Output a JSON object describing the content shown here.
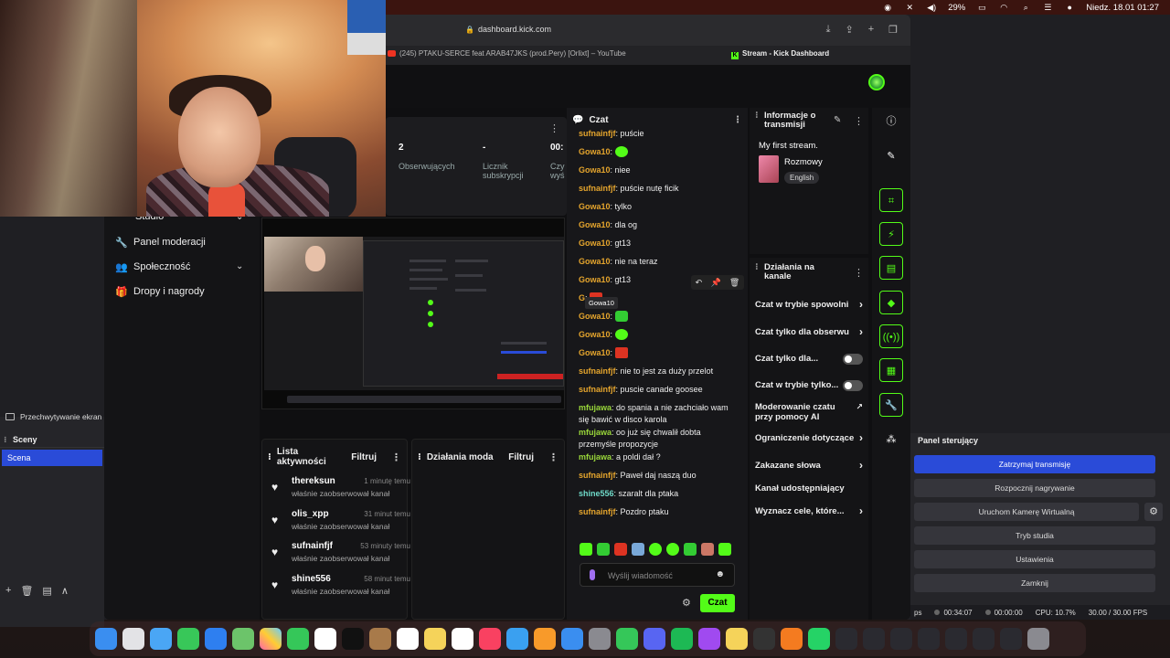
{
  "menubar": {
    "battery": "29%",
    "datetime": "Niedz. 18.01  01:27"
  },
  "obs": {
    "capture_label": "Przechwytywanie ekran",
    "scenes_title": "Sceny",
    "scene_item": "Scena",
    "controls_title": "Panel sterujący",
    "buttons": {
      "stop_stream": "Zatrzymaj transmisję",
      "start_record": "Rozpocznij nagrywanie",
      "virtual_cam": "Uruchom Kamerę Wirtualną",
      "studio_mode": "Tryb studia",
      "settings": "Ustawienia",
      "exit": "Zamknij"
    },
    "status": {
      "left_cut": "ps",
      "stream_time": "00:34:07",
      "record_time": "00:00:00",
      "cpu": "CPU: 10.7%",
      "fps": "30.00 / 30.00 FPS"
    }
  },
  "browser": {
    "url": "dashboard.kick.com",
    "tabs": [
      "(245) PTAKU-SERCE feat ARAB47JKS (prod.Pery) [Orlixt] – YouTube",
      "Stream - Kick Dashboard"
    ]
  },
  "nav": {
    "studio": "Studio",
    "moderation": "Panel moderacji",
    "community": "Społeczność",
    "drops": "Dropy i nagrody"
  },
  "stats": {
    "followers_value": "2",
    "followers_label": "Obserwujących",
    "subs_value": "-",
    "subs_label": "Licznik subskrypcji",
    "time_value": "00:",
    "time_label": "Czy wyś"
  },
  "activity": {
    "title": "Lista aktywności",
    "filter": "Filtruj",
    "items": [
      {
        "name": "thereksun",
        "time": "1 minutę temu",
        "desc": "właśnie zaobserwował kanał"
      },
      {
        "name": "olis_xpp",
        "time": "31 minut temu",
        "desc": "właśnie zaobserwował kanał"
      },
      {
        "name": "sufnainfjf",
        "time": "53 minuty temu",
        "desc": "właśnie zaobserwował kanał"
      },
      {
        "name": "shine556",
        "time": "58 minut temu",
        "desc": "właśnie zaobserwował kanał"
      }
    ]
  },
  "modactions": {
    "title": "Działania moda",
    "filter": "Filtruj"
  },
  "chat": {
    "title": "Czat",
    "tooltip": "Gowa10",
    "messages": [
      {
        "user": "sufnainfjf",
        "text": "puście",
        "color": "#e5a52d"
      },
      {
        "user": "Gowa10",
        "text": "",
        "emote": "g",
        "color": "#e5a52d"
      },
      {
        "user": "Gowa10",
        "text": "niee",
        "color": "#e5a52d"
      },
      {
        "user": "sufnainfjf",
        "text": "puście nutę ficik",
        "color": "#e5a52d"
      },
      {
        "user": "Gowa10",
        "text": "tylko",
        "color": "#e5a52d"
      },
      {
        "user": "Gowa10",
        "text": "dla og",
        "color": "#e5a52d"
      },
      {
        "user": "Gowa10",
        "text": "gt13",
        "color": "#e5a52d"
      },
      {
        "user": "Gowa10",
        "text": "nie na teraz",
        "color": "#e5a52d"
      },
      {
        "user": "Gowa10",
        "text": "gt13",
        "color": "#e5a52d"
      },
      {
        "user": "G",
        "text": "",
        "emote": "r",
        "color": "#e5a52d"
      },
      {
        "user": "Gowa10",
        "text": "",
        "emote": "gc",
        "color": "#e5a52d"
      },
      {
        "user": "Gowa10",
        "text": "",
        "emote": "g",
        "color": "#e5a52d"
      },
      {
        "user": "Gowa10",
        "text": "",
        "emote": "r",
        "color": "#e5a52d"
      },
      {
        "user": "sufnainfjf",
        "text": "nie to jest za duży przelot",
        "color": "#e5a52d"
      },
      {
        "user": "sufnainfjf",
        "text": "puscie canade goosee",
        "color": "#e5a52d"
      },
      {
        "user": "mfujawa",
        "text": "do spania a nie zachciało wam się bawić w disco karola",
        "color": "#9ad83a"
      },
      {
        "user": "mfujawa",
        "text": "oo już się chwalił dobta przemyśle propozycje",
        "color": "#9ad83a"
      },
      {
        "user": "mfujawa",
        "text": "a poldi dał ?",
        "color": "#9ad83a"
      },
      {
        "user": "sufnainfjf",
        "text": "Paweł daj naszą duo",
        "color": "#e5a52d"
      },
      {
        "user": "shine556",
        "text": "szaralt dla ptaka",
        "color": "#6fd9c8"
      },
      {
        "user": "sufnainfjf",
        "text": "Pozdro ptaku",
        "color": "#e5a52d"
      }
    ],
    "placeholder": "Wyślij wiadomość",
    "send": "Czat"
  },
  "info": {
    "title": "Informacje o transmisji",
    "stream_title": "My first stream.",
    "category": "Rozmowy",
    "language": "English"
  },
  "channel_actions": {
    "title": "Działania na kanale",
    "rows": [
      "Czat w trybie spowolni",
      "Czat tylko dla obserwu",
      "Czat tylko dla...",
      "Czat w trybie tylko...",
      "Moderowanie czatu przy pomocy AI",
      "Ograniczenie dotyczące",
      "Zakazane słowa",
      "Kanał udostępniający",
      "Wyznacz cele, które..."
    ]
  }
}
